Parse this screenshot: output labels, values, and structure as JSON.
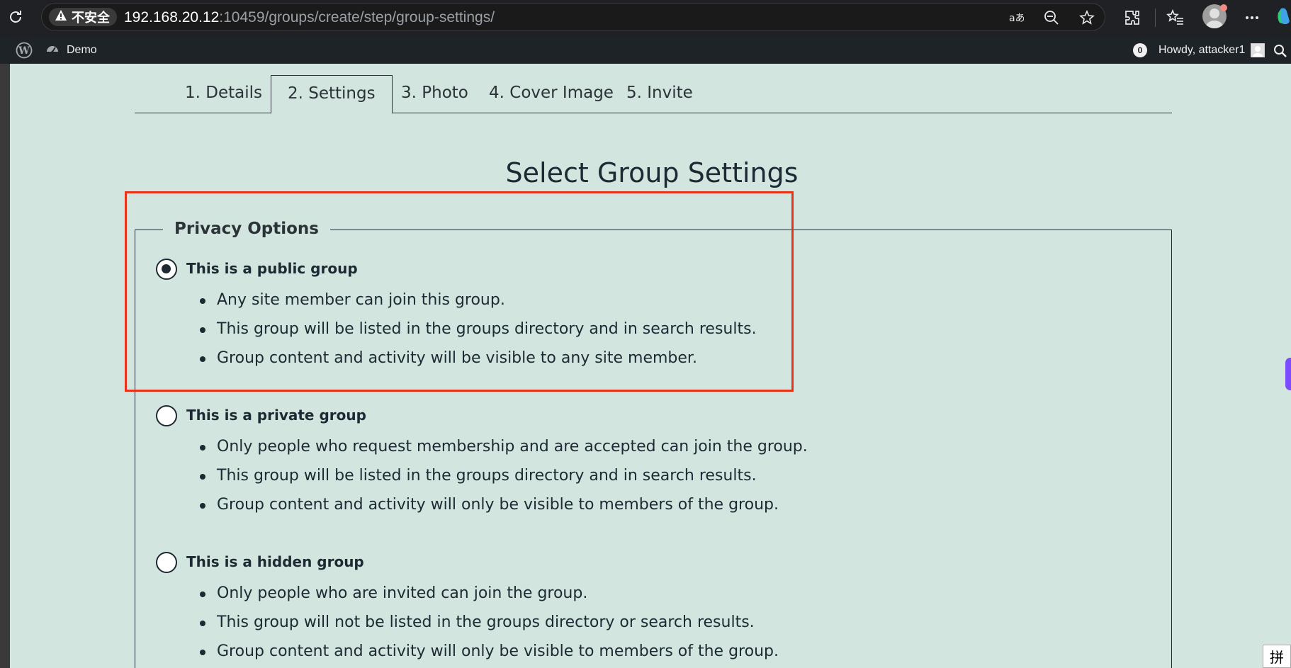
{
  "browser": {
    "security_label": "不安全",
    "url_host": "192.168.20.12",
    "url_rest": ":10459/groups/create/step/group-settings/"
  },
  "adminbar": {
    "site_name": "Demo",
    "notification_count": "0",
    "howdy": "Howdy, attacker1"
  },
  "tabs": [
    {
      "label": "1. Details",
      "active": false
    },
    {
      "label": "2. Settings",
      "active": true
    },
    {
      "label": "3. Photo",
      "active": false
    },
    {
      "label": "4. Cover Image",
      "active": false
    },
    {
      "label": "5. Invite",
      "active": false
    }
  ],
  "page_title": "Select Group Settings",
  "privacy": {
    "legend": "Privacy Options",
    "options": [
      {
        "label": "This is a public group",
        "checked": true,
        "bullets": [
          "Any site member can join this group.",
          "This group will be listed in the groups directory and in search results.",
          "Group content and activity will be visible to any site member."
        ]
      },
      {
        "label": "This is a private group",
        "checked": false,
        "bullets": [
          "Only people who request membership and are accepted can join the group.",
          "This group will be listed in the groups directory and in search results.",
          "Group content and activity will only be visible to members of the group."
        ]
      },
      {
        "label": "This is a hidden group",
        "checked": false,
        "bullets": [
          "Only people who are invited can join the group.",
          "This group will not be listed in the groups directory or search results.",
          "Group content and activity will only be visible to members of the group."
        ]
      }
    ]
  },
  "ime_indicator": "拼",
  "colors": {
    "page_background": "#d2e5df",
    "highlight_border": "#e8331b",
    "adminbar_background": "#1d2327"
  }
}
